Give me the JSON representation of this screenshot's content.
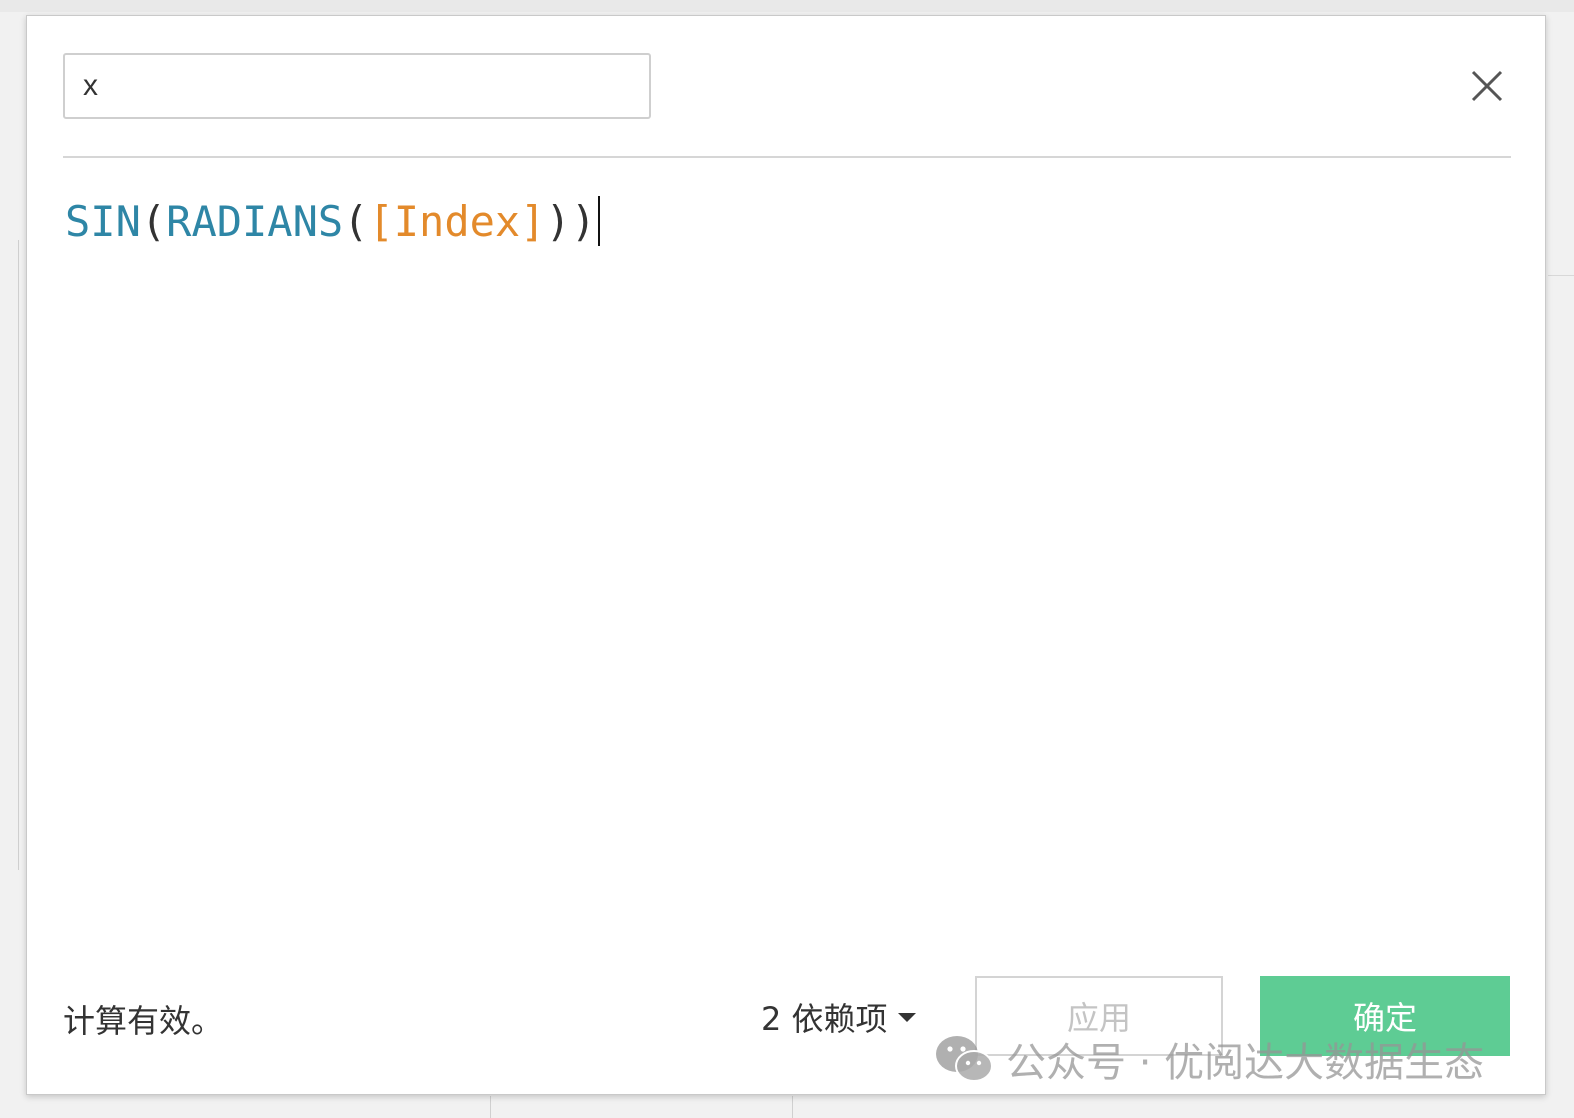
{
  "calc_name": {
    "value": "x"
  },
  "formula": {
    "function_outer": "SIN",
    "open_paren_1": "(",
    "function_inner": "RADIANS",
    "open_paren_2": "(",
    "field": "[Index]",
    "close_paren_1": ")",
    "close_paren_2": ")"
  },
  "footer": {
    "status": "计算有效。",
    "dependencies": "2 依赖项",
    "apply_label": "应用",
    "ok_label": "确定"
  },
  "watermark": {
    "text": "公众号 · 优阅达大数据生态"
  },
  "colors": {
    "function": "#2e86a6",
    "field": "#e38a2b",
    "ok_button": "#5ecc94"
  },
  "icons": {
    "close": "close-icon",
    "dependencies_dropdown": "chevron-down-icon",
    "side_panel_toggle": "triangle-right-icon",
    "watermark_logo": "wechat-icon"
  }
}
